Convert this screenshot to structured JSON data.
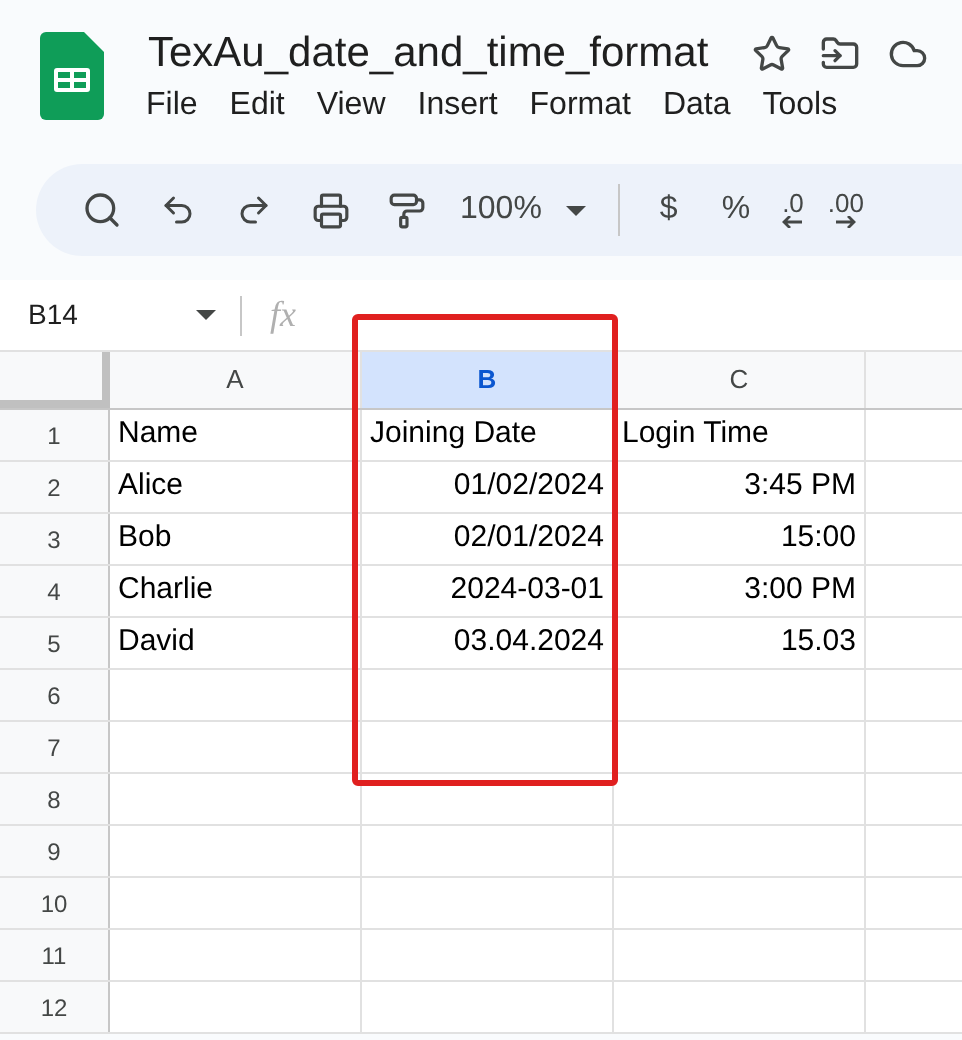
{
  "document": {
    "title": "TexAu_date_and_time_format"
  },
  "menu": [
    "File",
    "Edit",
    "View",
    "Insert",
    "Format",
    "Data",
    "Tools"
  ],
  "toolbar": {
    "zoom": "100%",
    "currency": "$",
    "percent": "%",
    "decrease_decimal": ".0",
    "increase_decimal": ".00"
  },
  "name_box": {
    "value": "B14"
  },
  "formula_bar": {
    "label": "fx"
  },
  "columns": [
    {
      "label": "A",
      "selected": false
    },
    {
      "label": "B",
      "selected": true
    },
    {
      "label": "C",
      "selected": false
    }
  ],
  "rows": [
    {
      "number": "1",
      "cells": [
        {
          "text": "Name",
          "kind": "text"
        },
        {
          "text": "Joining Date",
          "kind": "text"
        },
        {
          "text": "Login Time",
          "kind": "text"
        }
      ]
    },
    {
      "number": "2",
      "cells": [
        {
          "text": "Alice",
          "kind": "text"
        },
        {
          "text": "01/02/2024",
          "kind": "value"
        },
        {
          "text": "3:45 PM",
          "kind": "value"
        }
      ]
    },
    {
      "number": "3",
      "cells": [
        {
          "text": "Bob",
          "kind": "text"
        },
        {
          "text": "02/01/2024",
          "kind": "value"
        },
        {
          "text": "15:00",
          "kind": "value"
        }
      ]
    },
    {
      "number": "4",
      "cells": [
        {
          "text": "Charlie",
          "kind": "text"
        },
        {
          "text": "2024-03-01",
          "kind": "value"
        },
        {
          "text": "3:00 PM",
          "kind": "value"
        }
      ]
    },
    {
      "number": "5",
      "cells": [
        {
          "text": "David",
          "kind": "text"
        },
        {
          "text": "03.04.2024",
          "kind": "value"
        },
        {
          "text": "15.03",
          "kind": "value"
        }
      ]
    },
    {
      "number": "6",
      "cells": []
    },
    {
      "number": "7",
      "cells": []
    },
    {
      "number": "8",
      "cells": []
    },
    {
      "number": "9",
      "cells": []
    },
    {
      "number": "10",
      "cells": []
    },
    {
      "number": "11",
      "cells": []
    },
    {
      "number": "12",
      "cells": []
    }
  ]
}
